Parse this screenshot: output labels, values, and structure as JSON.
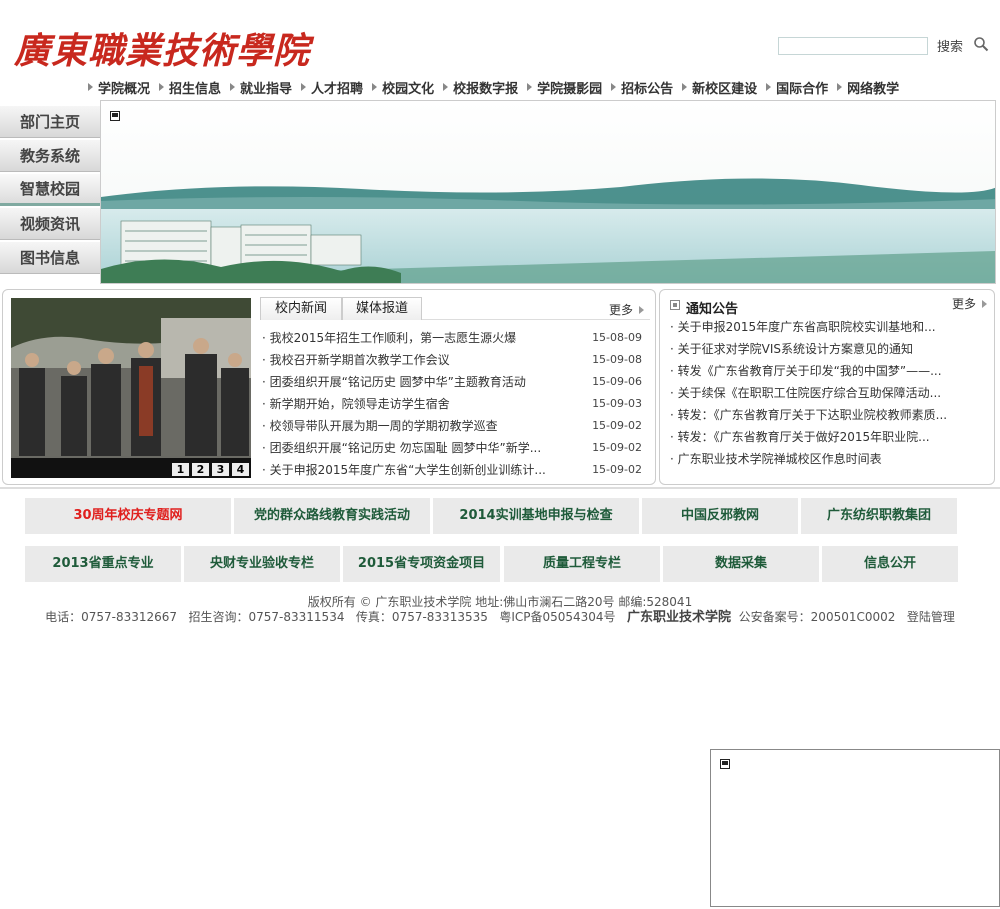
{
  "header": {
    "logo_text": "廣東職業技術學院",
    "search": {
      "placeholder": "",
      "button_label": "搜索"
    }
  },
  "topnav": [
    "学院概况",
    "招生信息",
    "就业指导",
    "人才招聘",
    "校园文化",
    "校报数字报",
    "学院摄影园",
    "招标公告",
    "新校区建设",
    "国际合作",
    "网络教学"
  ],
  "sidenav": [
    "部门主页",
    "教务系统",
    "智慧校园",
    "视频资讯",
    "图书信息"
  ],
  "news": {
    "tabs": [
      "校内新闻",
      "媒体报道"
    ],
    "more_label": "更多",
    "pager": [
      "1",
      "2",
      "3",
      "4"
    ],
    "items": [
      {
        "title": "我校2015年招生工作顺利，第一志愿生源火爆",
        "date": "15-08-09"
      },
      {
        "title": "我校召开新学期首次教学工作会议",
        "date": "15-09-08"
      },
      {
        "title": "团委组织开展“铭记历史 圆梦中华”主题教育活动",
        "date": "15-09-06"
      },
      {
        "title": "新学期开始，院领导走访学生宿舍",
        "date": "15-09-03"
      },
      {
        "title": "校领导带队开展为期一周的学期初教学巡查",
        "date": "15-09-02"
      },
      {
        "title": "团委组织开展“铭记历史 勿忘国耻 圆梦中华”新学...",
        "date": "15-09-02"
      },
      {
        "title": "关于申报2015年度广东省“大学生创新创业训练计...",
        "date": "15-09-02"
      }
    ]
  },
  "notices": {
    "title": "通知公告",
    "more_label": "更多",
    "items": [
      "关于申报2015年度广东省高职院校实训基地和...",
      "关于征求对学院VIS系统设计方案意见的通知",
      "转发《广东省教育厅关于印发“我的中国梦”——...",
      " 关于续保《在职职工住院医疗综合互助保障活动...",
      "转发：《广东省教育厅关于下达职业院校教师素质...",
      "转发：《广东省教育厅关于做好2015年职业院...",
      "广东职业技术学院禅城校区作息时间表"
    ]
  },
  "links_row1": [
    "30周年校庆专题网",
    "党的群众路线教育实践活动",
    "2014实训基地申报与检查",
    "中国反邪教网",
    "广东纺织职教集团"
  ],
  "links_row2": [
    "2013省重点专业",
    "央财专业验收专栏",
    "2015省专项资金项目",
    "质量工程专栏",
    "数据采集",
    "信息公开"
  ],
  "footer": {
    "line1": "版权所有 © 广东职业技术学院   地址:佛山市澜石二路20号 邮编:528041",
    "phone": "电话：0757-83312667",
    "admission": "招生咨询：0757-83311534",
    "fax": "传真：0757-83313535",
    "icp": "粤ICP备05054304号",
    "school": "广东职业技术学院",
    "police": "公安备案号：200501C0002",
    "login": "登陆管理"
  },
  "colors": {
    "logo_red": "#c8281e",
    "link_green": "#1f5b3a",
    "link_red": "#e0201e"
  }
}
